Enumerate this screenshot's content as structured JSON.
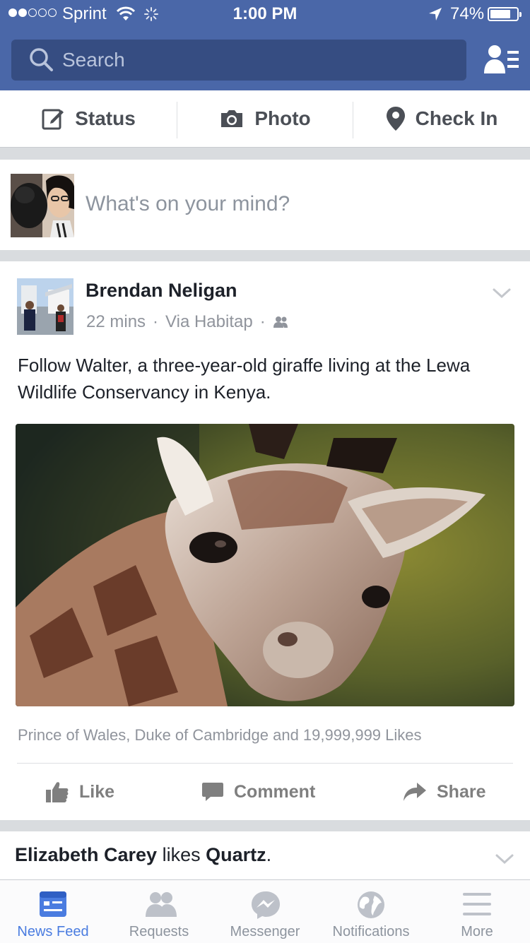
{
  "status_bar": {
    "carrier": "Sprint",
    "time": "1:00 PM",
    "battery": "74%"
  },
  "search": {
    "placeholder": "Search"
  },
  "composer": {
    "actions": [
      {
        "label": "Status",
        "icon": "edit-icon"
      },
      {
        "label": "Photo",
        "icon": "camera-icon"
      },
      {
        "label": "Check In",
        "icon": "location-pin-icon"
      }
    ],
    "placeholder": "What's on your mind?"
  },
  "post": {
    "author": "Brendan Neligan",
    "time": "22 mins",
    "via": "Via Habitap",
    "audience_icon": "friends-audience-icon",
    "text": "Follow Walter, a three-year-old giraffe living at the Lewa Wildlife Conservancy in Kenya.",
    "likes_summary": "Prince of Wales, Duke of Cambridge and 19,999,999 Likes",
    "actions": {
      "like": "Like",
      "comment": "Comment",
      "share": "Share"
    }
  },
  "next_story": {
    "actor": "Elizabeth Carey",
    "verb": "likes",
    "page": "Quartz",
    "punct": "."
  },
  "tabs": [
    {
      "label": "News Feed",
      "icon": "news-feed-icon",
      "active": true
    },
    {
      "label": "Requests",
      "icon": "requests-icon"
    },
    {
      "label": "Messenger",
      "icon": "messenger-icon"
    },
    {
      "label": "Notifications",
      "icon": "globe-icon"
    },
    {
      "label": "More",
      "icon": "menu-icon"
    }
  ],
  "colors": {
    "brand": "#4a67a8",
    "search_field": "#364d82",
    "active_tab": "#4a7ce0",
    "muted_text": "#90949c"
  }
}
